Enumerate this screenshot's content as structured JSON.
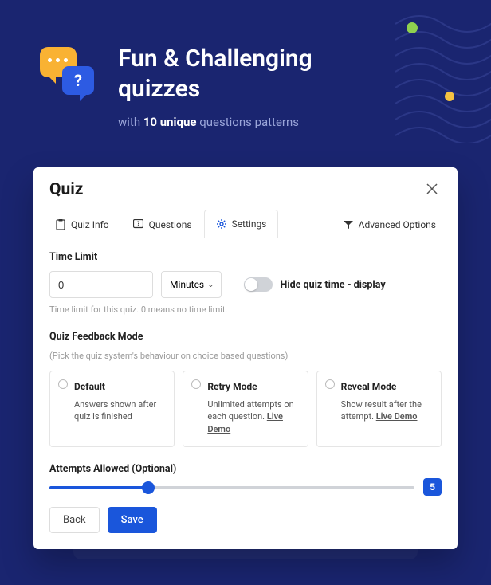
{
  "hero": {
    "title_line1": "Fun & Challenging",
    "title_line2": "quizzes",
    "sub_prefix": "with ",
    "sub_strong": "10 unique",
    "sub_suffix": " questions patterns",
    "bubble2_char": "?"
  },
  "card": {
    "title": "Quiz",
    "tabs": {
      "quiz_info": "Quiz Info",
      "questions": "Questions",
      "settings": "Settings",
      "advanced": "Advanced Options"
    },
    "time_limit": {
      "label": "Time Limit",
      "value": "0",
      "unit": "Minutes",
      "toggle_label": "Hide quiz time - display",
      "hint": "Time limit for this quiz. 0 means no time limit."
    },
    "feedback": {
      "label": "Quiz Feedback Mode",
      "hint": "(Pick the quiz system's behaviour on choice based questions)",
      "modes": [
        {
          "title": "Default",
          "desc": "Answers shown after quiz is finished",
          "demo": ""
        },
        {
          "title": "Retry Mode",
          "desc": "Unlimited attempts on each question. ",
          "demo": "Live Demo"
        },
        {
          "title": "Reveal Mode",
          "desc": "Show result after the attempt. ",
          "demo": "Live Demo"
        }
      ]
    },
    "attempts": {
      "label": "Attempts Allowed (Optional)",
      "value": "5"
    },
    "buttons": {
      "back": "Back",
      "save": "Save"
    }
  }
}
